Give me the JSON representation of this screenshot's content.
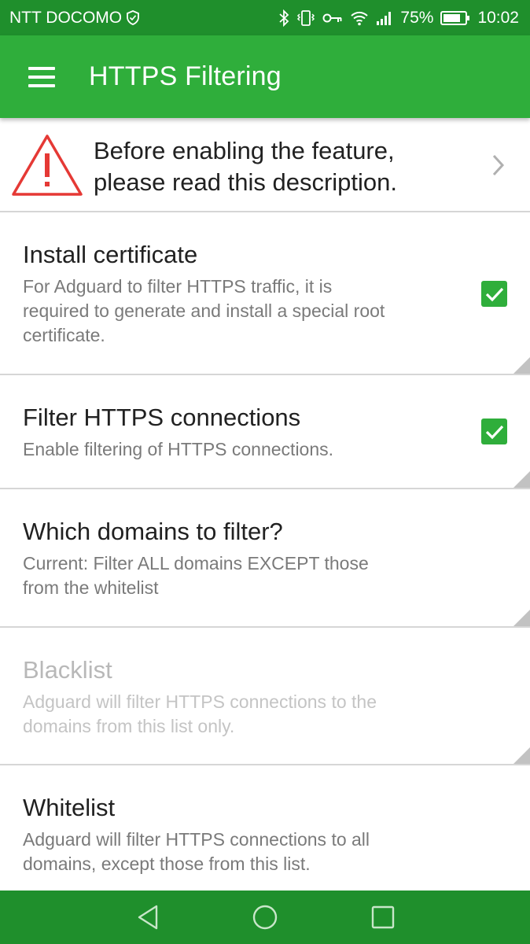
{
  "status_bar": {
    "carrier": "NTT DOCOMO",
    "battery": "75%",
    "time": "10:02",
    "icons": [
      "shield-icon",
      "bluetooth-icon",
      "vibrate-icon",
      "vpn-key-icon",
      "wifi-icon",
      "signal-icon",
      "battery-icon"
    ]
  },
  "app_bar": {
    "title": "HTTPS Filtering",
    "menu_icon": "hamburger-menu-icon"
  },
  "notice": {
    "line1": "Before enabling the feature,",
    "line2": "please read this description.",
    "icon": "warning-icon"
  },
  "settings": [
    {
      "title": "Install certificate",
      "desc_lines": [
        "For Adguard to filter HTTPS traffic, it is",
        "required to generate and install a special root",
        "certificate."
      ],
      "checked": true
    },
    {
      "title": "Filter HTTPS connections",
      "desc_lines": [
        "Enable filtering of HTTPS connections."
      ],
      "checked": true
    },
    {
      "title": "Which domains to filter?",
      "desc_lines": [
        "Current: Filter ALL domains EXCEPT those",
        "from the whitelist"
      ]
    },
    {
      "title": "Blacklist",
      "desc_lines": [
        "Adguard will filter HTTPS connections to the",
        "domains from this list only."
      ],
      "enabled": false
    },
    {
      "title": "Whitelist",
      "desc_lines": [
        "Adguard will filter HTTPS connections to all",
        "domains, except those from this list."
      ]
    }
  ],
  "colors": {
    "status_bar": "#1f8f2c",
    "app_bar": "#2fae3b",
    "warning": "#e53935",
    "accent": "#2fae3b"
  },
  "nav_bar": {
    "icons": [
      "back-icon",
      "home-icon",
      "recents-icon"
    ]
  }
}
